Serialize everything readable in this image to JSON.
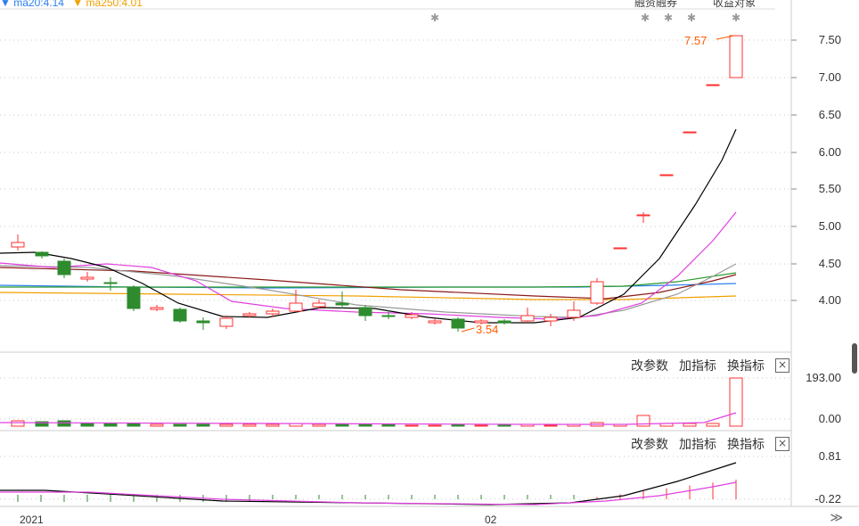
{
  "legend": {
    "items": [
      {
        "text": "ma20:4.14",
        "color": "#2a7ef0"
      },
      {
        "text": "ma250:4.01",
        "color": "#f0a000"
      }
    ]
  },
  "top_labels": {
    "left": "融资融券",
    "right": "收益对象"
  },
  "price_axis": {
    "ticks": [
      "7.50",
      "7.00",
      "6.50",
      "6.00",
      "5.50",
      "5.00",
      "4.50",
      "4.00"
    ]
  },
  "annotations": {
    "high": "7.57",
    "low": "3.54"
  },
  "volume_panel": {
    "toolbar": {
      "modify": "改参数",
      "add": "加指标",
      "switch": "换指标",
      "close": "×"
    },
    "ticks": [
      "193.00",
      "0.00"
    ]
  },
  "indicator_panel": {
    "toolbar": {
      "modify": "改参数",
      "add": "加指标",
      "switch": "换指标",
      "close": "×"
    },
    "ticks": [
      "0.81",
      "-0.22"
    ]
  },
  "x_axis": {
    "labels": [
      "2021",
      "02"
    ]
  },
  "nav": {
    "more": "≫"
  },
  "colors": {
    "up": "#ff3030",
    "down": "#2e8b2e",
    "ma5": "#000000",
    "ma10": "#e040e0",
    "ma20": "#2a7ef0",
    "ma30": "#2a9a2a",
    "ma60": "#8b1a1a",
    "ma120": "#999999",
    "ma250": "#f0a000"
  }
}
